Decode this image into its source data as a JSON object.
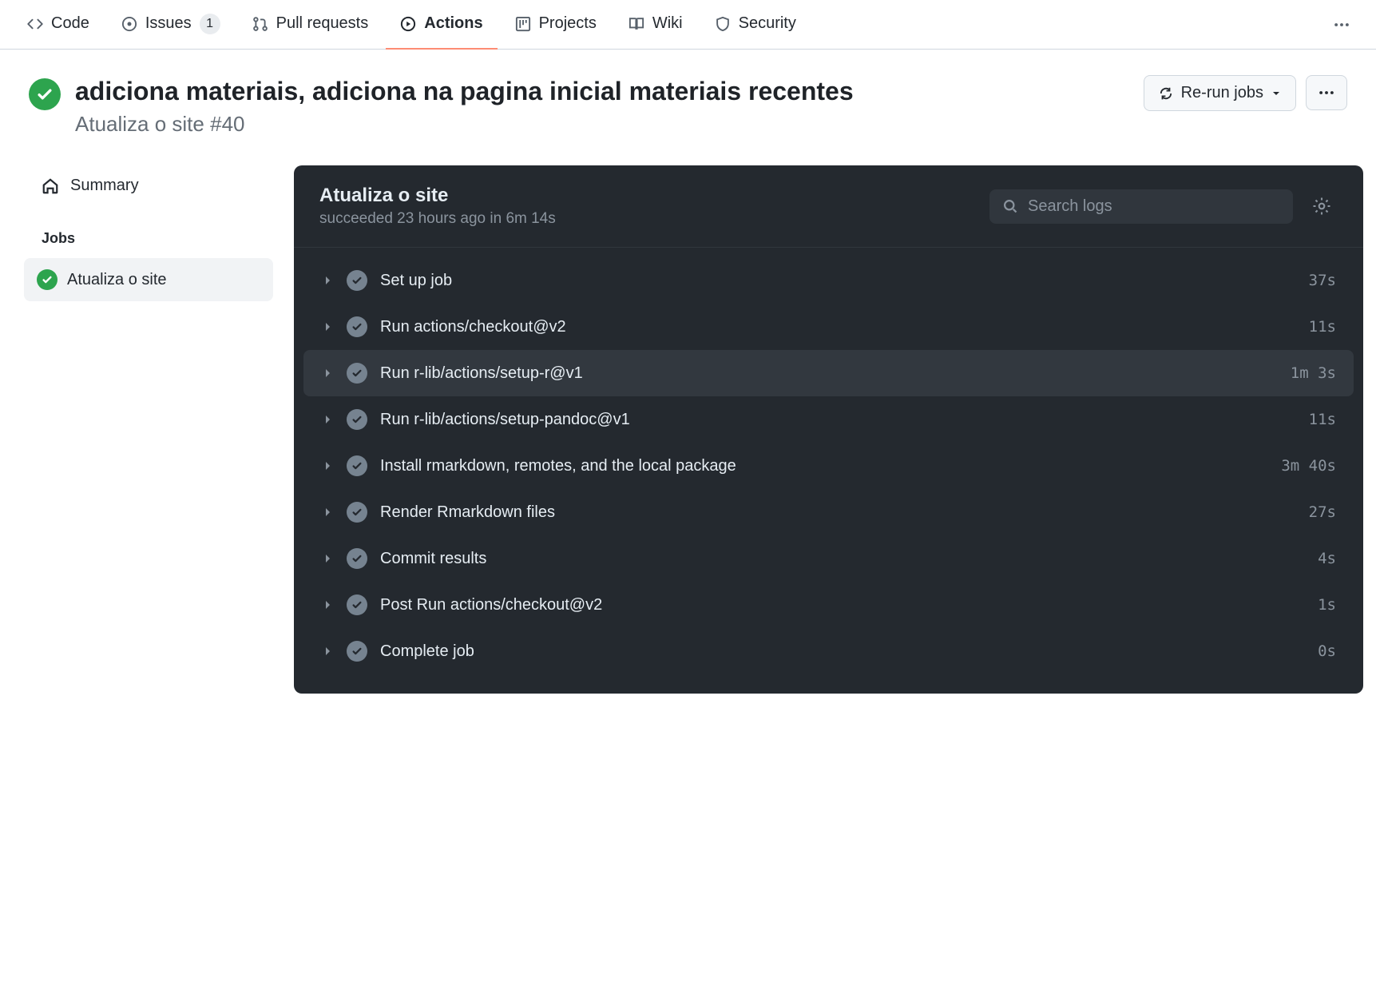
{
  "topnav": {
    "items": [
      {
        "label": "Code"
      },
      {
        "label": "Issues",
        "count": "1"
      },
      {
        "label": "Pull requests"
      },
      {
        "label": "Actions"
      },
      {
        "label": "Projects"
      },
      {
        "label": "Wiki"
      },
      {
        "label": "Security"
      }
    ]
  },
  "header": {
    "title": "adiciona materiais, adiciona na pagina inicial materiais recentes",
    "workflow_name": "Atualiza o site",
    "run_number": "#40",
    "rerun_label": "Re-run jobs"
  },
  "sidebar": {
    "summary_label": "Summary",
    "jobs_heading": "Jobs",
    "jobs": [
      {
        "name": "Atualiza o site"
      }
    ]
  },
  "job_panel": {
    "title": "Atualiza o site",
    "status_line": "succeeded 23 hours ago in 6m 14s",
    "search_placeholder": "Search logs",
    "steps": [
      {
        "name": "Set up job",
        "duration": "37s"
      },
      {
        "name": "Run actions/checkout@v2",
        "duration": "11s"
      },
      {
        "name": "Run r-lib/actions/setup-r@v1",
        "duration": "1m 3s",
        "hover": true
      },
      {
        "name": "Run r-lib/actions/setup-pandoc@v1",
        "duration": "11s"
      },
      {
        "name": "Install rmarkdown, remotes, and the local package",
        "duration": "3m 40s"
      },
      {
        "name": "Render Rmarkdown files",
        "duration": "27s"
      },
      {
        "name": "Commit results",
        "duration": "4s"
      },
      {
        "name": "Post Run actions/checkout@v2",
        "duration": "1s"
      },
      {
        "name": "Complete job",
        "duration": "0s"
      }
    ]
  }
}
